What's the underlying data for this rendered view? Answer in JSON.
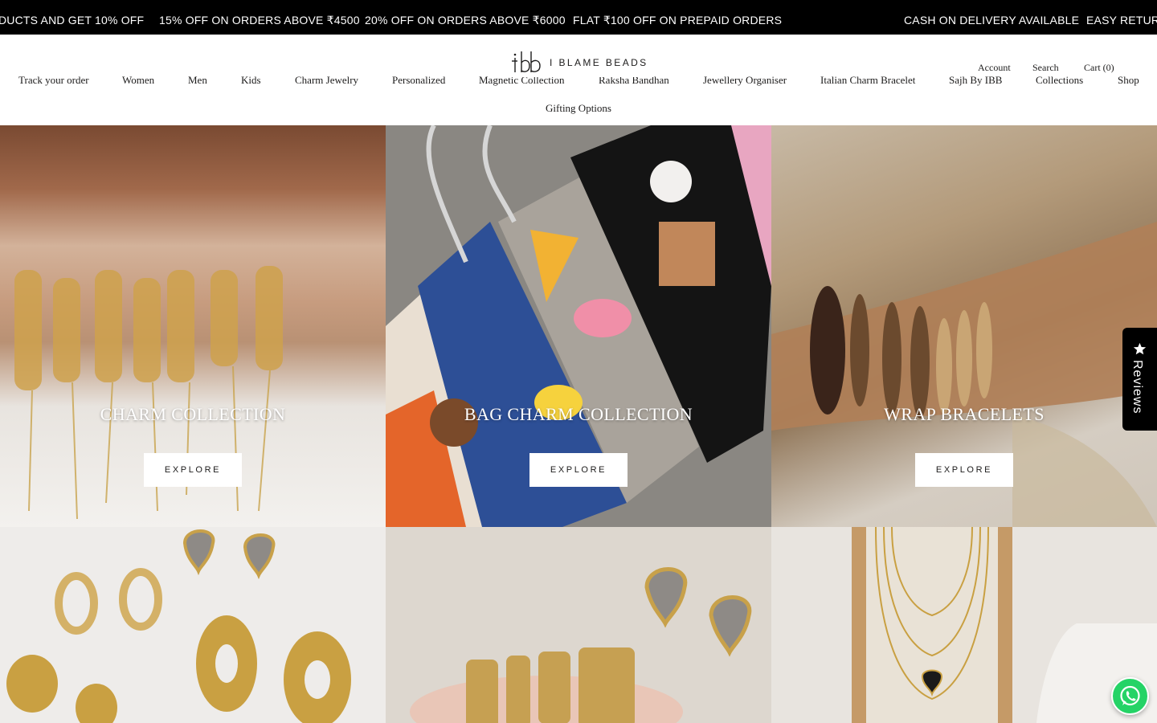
{
  "announcement": {
    "items": [
      "DUCTS AND GET 10% OFF",
      "15% OFF ON ORDERS ABOVE ₹4500",
      "20% OFF ON ORDERS ABOVE ₹6000",
      "FLAT ₹100 OFF ON PREPAID ORDERS",
      "CASH ON DELIVERY AVAILABLE",
      "EASY RETURN"
    ]
  },
  "header": {
    "logo_text": "I BLAME BEADS",
    "nav": [
      "Track your order",
      "Women",
      "Men",
      "Kids",
      "Charm Jewelry",
      "Personalized",
      "Magnetic Collection",
      "Raksha Bandhan",
      "Jewellery Organiser",
      "Italian Charm Bracelet",
      "Sajh By IBB",
      "Collections",
      "Shop",
      "Gifting Options"
    ],
    "account": "Account",
    "search": "Search",
    "cart": "Cart (0)"
  },
  "collections": [
    {
      "title": "CHARM COLLECTION",
      "button": "EXPLORE"
    },
    {
      "title": "BAG CHARM COLLECTION",
      "button": "EXPLORE"
    },
    {
      "title": "WRAP BRACELETS",
      "button": "EXPLORE"
    }
  ],
  "reviews_tab": {
    "label": "Reviews"
  },
  "colors": {
    "announcement_bg": "#000000",
    "whatsapp": "#25D366",
    "text": "#1C1B1B"
  },
  "icons": [
    "star-icon",
    "whatsapp-icon",
    "ibb-logo-mark"
  ]
}
